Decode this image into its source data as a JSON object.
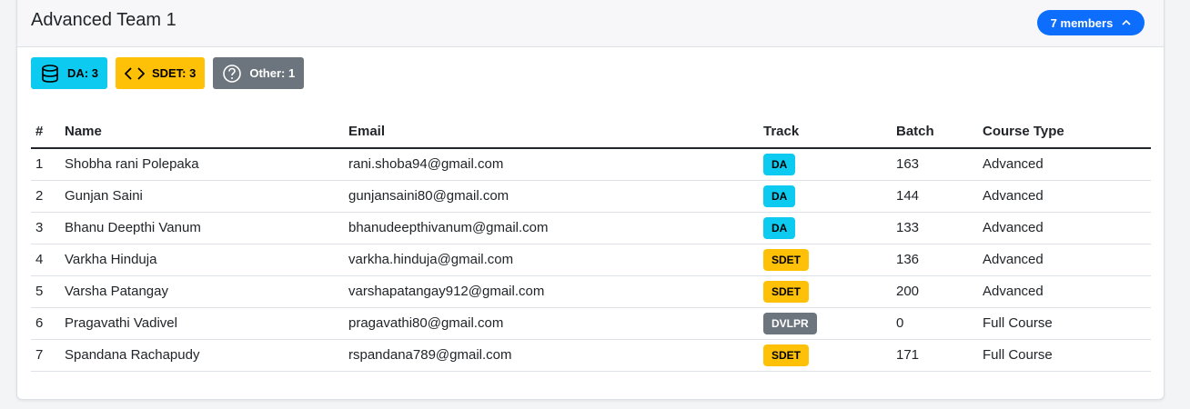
{
  "card": {
    "title": "Advanced Team 1",
    "members_label": "7 members"
  },
  "summary_badges": [
    {
      "label": "DA: 3",
      "icon": "database-icon",
      "color": "#0dcaf0"
    },
    {
      "label": "SDET: 3",
      "icon": "code-icon",
      "color": "#ffc107"
    },
    {
      "label": "Other: 1",
      "icon": "question-circle-icon",
      "color": "#6c757d"
    }
  ],
  "table": {
    "headers": [
      "#",
      "Name",
      "Email",
      "Track",
      "Batch",
      "Course Type"
    ],
    "rows": [
      {
        "num": "1",
        "name": "Shobha rani Polepaka",
        "email": "rani.shoba94@gmail.com",
        "track": "DA",
        "batch": "163",
        "course": "Advanced"
      },
      {
        "num": "2",
        "name": "Gunjan Saini",
        "email": "gunjansaini80@gmail.com",
        "track": "DA",
        "batch": "144",
        "course": "Advanced"
      },
      {
        "num": "3",
        "name": "Bhanu Deepthi Vanum",
        "email": "bhanudeepthivanum@gmail.com",
        "track": "DA",
        "batch": "133",
        "course": "Advanced"
      },
      {
        "num": "4",
        "name": "Varkha Hinduja",
        "email": "varkha.hinduja@gmail.com",
        "track": "SDET",
        "batch": "136",
        "course": "Advanced"
      },
      {
        "num": "5",
        "name": "Varsha Patangay",
        "email": "varshapatangay912@gmail.com",
        "track": "SDET",
        "batch": "200",
        "course": "Advanced"
      },
      {
        "num": "6",
        "name": "Pragavathi Vadivel",
        "email": "pragavathi80@gmail.com",
        "track": "DVLPR",
        "batch": "0",
        "course": "Full Course"
      },
      {
        "num": "7",
        "name": "Spandana Rachapudy",
        "email": "rspandana789@gmail.com",
        "track": "SDET",
        "batch": "171",
        "course": "Full Course"
      }
    ]
  }
}
